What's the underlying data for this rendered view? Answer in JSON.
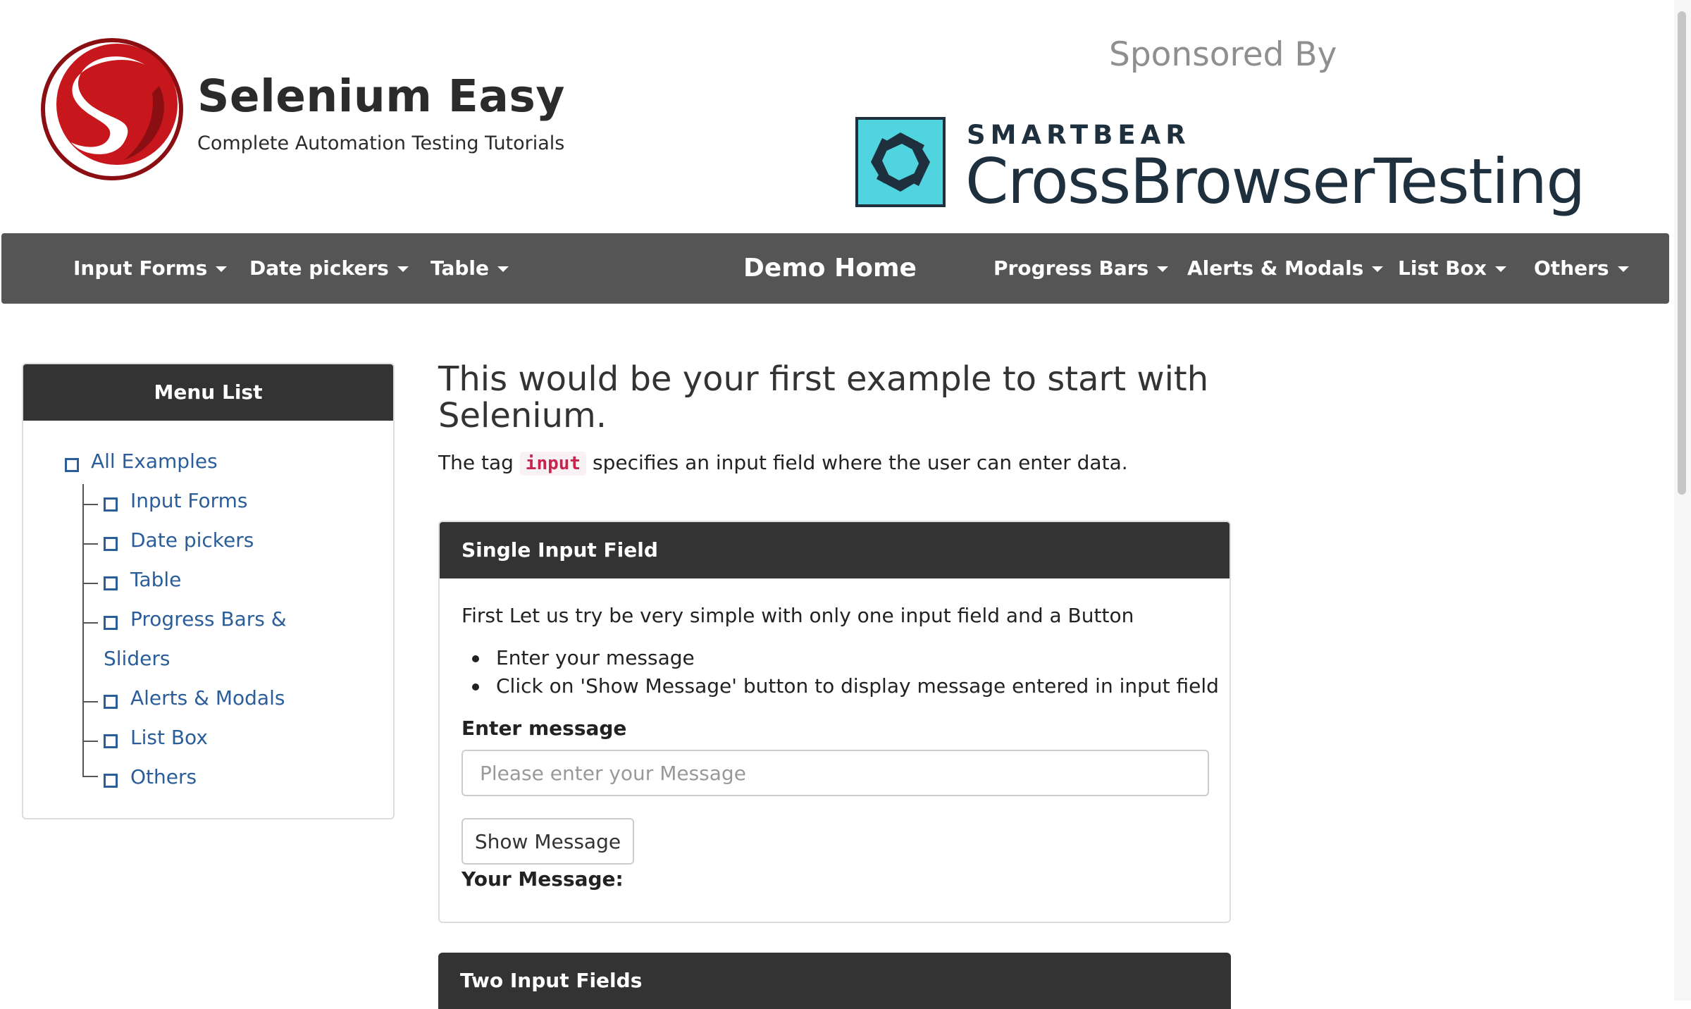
{
  "brand": {
    "title": "Selenium Easy",
    "tagline": "Complete Automation Testing Tutorials",
    "logo_icon": "selenium-s-logo"
  },
  "sponsor": {
    "heading": "Sponsored By",
    "company": "SMARTBEAR",
    "product": "CrossBrowserTesting",
    "logo_color": "#4fd4e0"
  },
  "navbar": {
    "items": [
      {
        "label": "Input Forms"
      },
      {
        "label": "Date pickers"
      },
      {
        "label": "Table"
      },
      {
        "label": "Demo Home"
      },
      {
        "label": "Progress Bars"
      },
      {
        "label": "Alerts & Modals"
      },
      {
        "label": "List Box"
      },
      {
        "label": "Others"
      }
    ],
    "background": "#555555"
  },
  "sidebar": {
    "heading": "Menu List",
    "root": "All Examples",
    "items": [
      {
        "label": "Input Forms"
      },
      {
        "label": "Date pickers"
      },
      {
        "label": "Table"
      },
      {
        "label": "Progress Bars &"
      },
      {
        "label": "Sliders"
      },
      {
        "label": "Alerts & Modals"
      },
      {
        "label": "List Box"
      },
      {
        "label": "Others"
      }
    ],
    "link_color": "#2a5d99"
  },
  "main": {
    "title": "This would be your first example to start with Selenium.",
    "intro_before": "The tag",
    "intro_code": "input",
    "intro_after": "specifies an input field where the user can enter data."
  },
  "panel_single": {
    "heading": "Single Input Field",
    "lead": "First Let us try be very simple with only one input field and a Button",
    "bullets": [
      "Enter your message",
      "Click on 'Show Message' button to display message entered in input field"
    ],
    "field_label": "Enter message",
    "input_value": "",
    "input_placeholder": "Please enter your Message",
    "button_label": "Show Message",
    "result_label": "Your Message:"
  },
  "panel_two": {
    "heading": "Two Input Fields"
  }
}
